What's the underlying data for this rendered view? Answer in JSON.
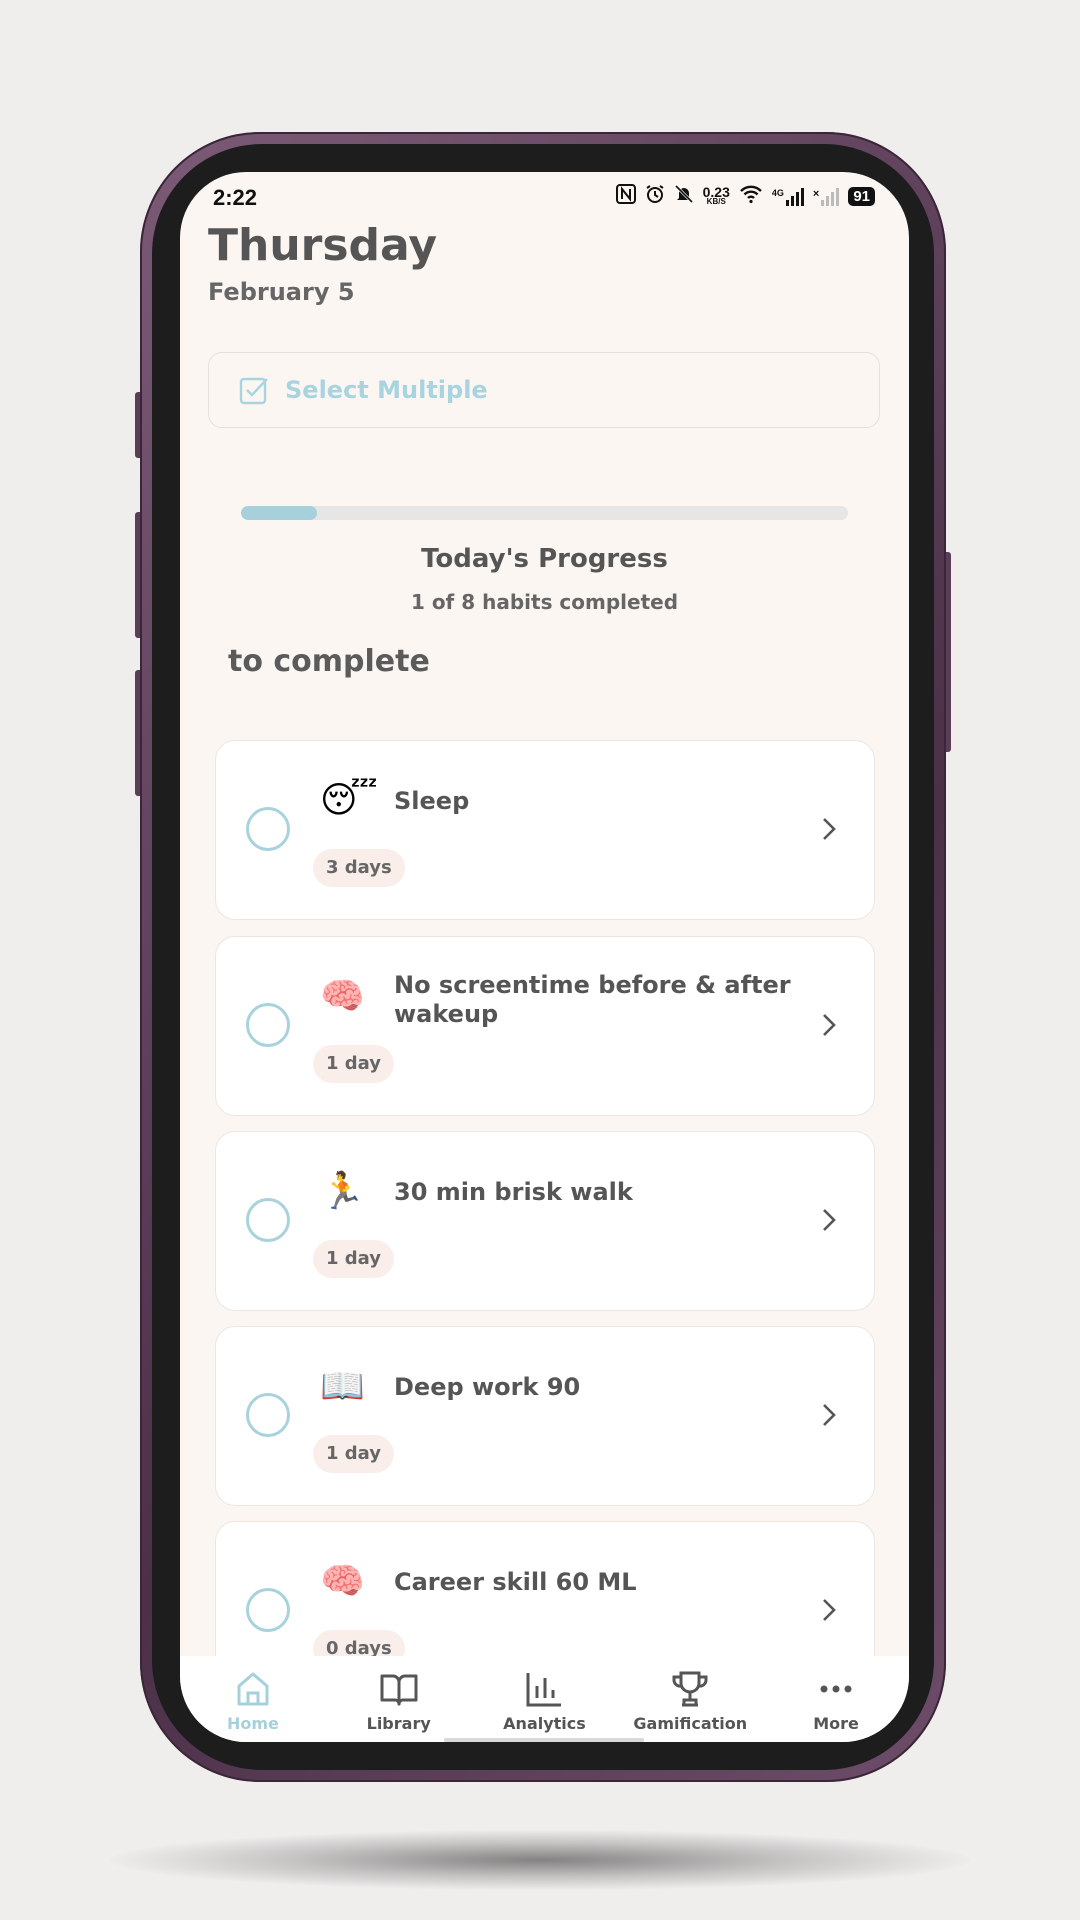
{
  "status_bar": {
    "time": "2:22",
    "net_speed": "0.23",
    "net_unit": "KB/S",
    "net_type": "4G",
    "battery": "91"
  },
  "header": {
    "day": "Thursday",
    "date": "February 5"
  },
  "select_multiple": {
    "label": "Select Multiple",
    "icon": "checkbox-icon",
    "color": "#a8d4e0"
  },
  "progress": {
    "title": "Today's Progress",
    "subtitle": "1 of 8 habits completed",
    "fraction": 0.125,
    "fill_color": "#a6d0db"
  },
  "section_title": "to complete",
  "habits": [
    {
      "emoji": "😴",
      "name": "Sleep",
      "streak": "3 days"
    },
    {
      "emoji": "🧠",
      "name": "No screentime before & after wakeup",
      "streak": "1 day"
    },
    {
      "emoji": "🏃",
      "name": "30 min brisk walk",
      "streak": "1 day"
    },
    {
      "emoji": "📖",
      "name": "Deep work 90",
      "streak": "1 day"
    },
    {
      "emoji": "🧠",
      "name": "Career skill 60 ML",
      "streak": "0 days"
    }
  ],
  "nav": [
    {
      "label": "Home",
      "icon": "home-icon",
      "active": true
    },
    {
      "label": "Library",
      "icon": "book-icon",
      "active": false
    },
    {
      "label": "Analytics",
      "icon": "bar-chart-icon",
      "active": false
    },
    {
      "label": "Gamification",
      "icon": "trophy-icon",
      "active": false
    },
    {
      "label": "More",
      "icon": "more-icon",
      "active": false
    }
  ]
}
